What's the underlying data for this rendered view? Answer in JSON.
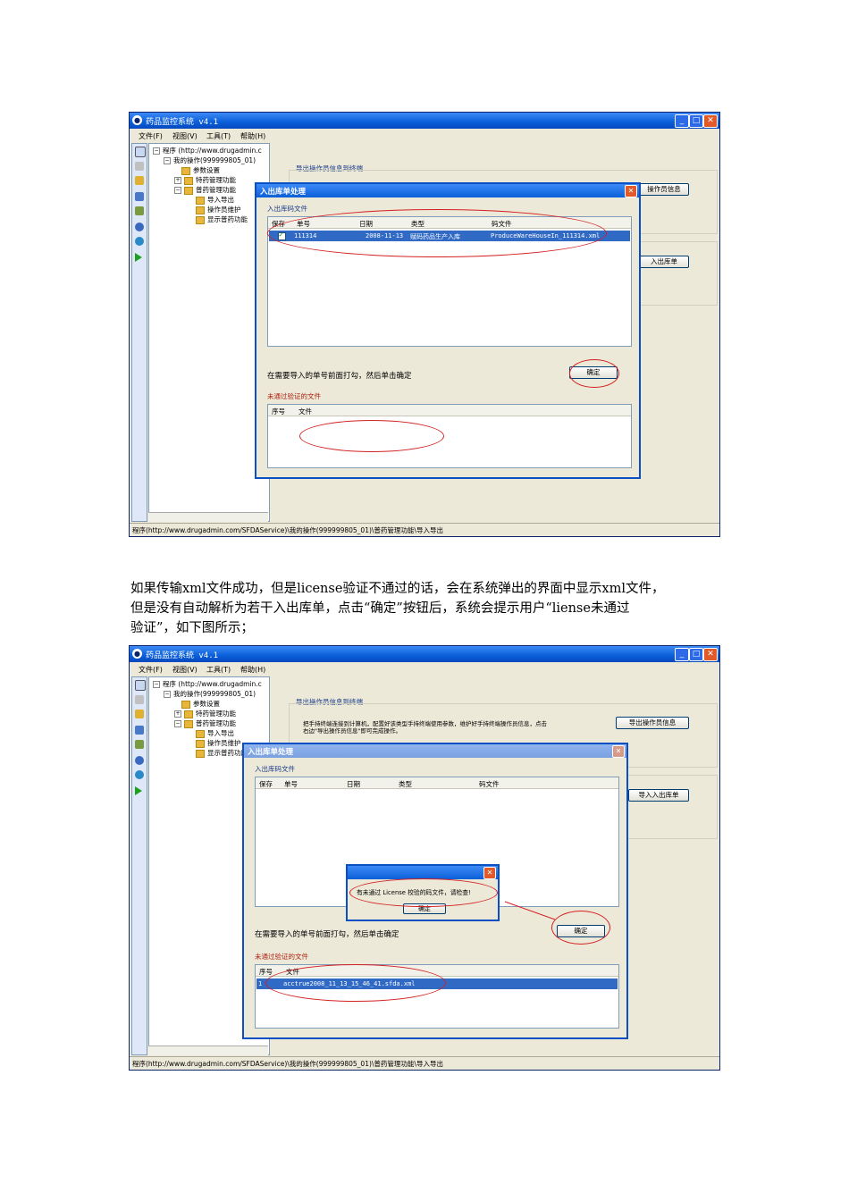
{
  "window": {
    "title": "药品监控系统 v4.1",
    "menu": [
      "文件(F)",
      "视图(V)",
      "工具(T)",
      "帮助(H)"
    ]
  },
  "tree": {
    "root": "程序 (http://www.drugadmin.c",
    "ops": "我的操作(999999805_01)",
    "param": "参数设置",
    "special": "特药管理功能",
    "general": "普药管理功能",
    "import_export": "导入导出",
    "operator_maintain": "操作员维护",
    "show_general": "显示普药功能"
  },
  "status_path": "程序(http://www.drugadmin.com/SFDAService)\\我的操作(999999805_01)\\普药管理功能\\导入导出",
  "right_panel": {
    "group1_title": "导出操作员信息到终端",
    "group1_desc_line1": "把手持终端连接到计算机，配置好该类型手持终端使用参数，维护好手持终端操作员信息，点击",
    "group1_desc_line2": "右边\"导出操作员信息\"即可完成操作。",
    "export_btn_full": "导出操作员信息",
    "export_btn_partial": "操作员信息",
    "import_btn_full": "导入入出库单",
    "import_btn_partial": "入出库单"
  },
  "dialog": {
    "title": "入出库单处理",
    "section1": "入出库码文件",
    "columns": [
      "保存",
      "单号",
      "日期",
      "类型",
      "码文件"
    ],
    "row": {
      "number": "111314",
      "date": "2008-11-13",
      "type": "赋码药品生产入库",
      "file": "ProduceWareHouseIn_111314.xml"
    },
    "hint": "在需要导入的单号前面打勾，然后单击确定",
    "ok": "确定",
    "section2": "未通过验证的文件",
    "columns2": [
      "序号",
      "文件"
    ],
    "failed_row": {
      "index": "1",
      "file": "acctrue2008_11_13_15_46_41.sfda.xml"
    }
  },
  "alert": {
    "message": "有未通过 License 校验的码文件，请检查!",
    "ok": "确定"
  },
  "paragraph": [
    "如果传输xml文件成功，但是license验证不通过的话，会在系统弹出的界面中显示xml文件，",
    "但是没有自动解析为若干入出库单，点击“确定”按钮后，系统会提示用户“liense未通过",
    "验证”，如下图所示；"
  ]
}
